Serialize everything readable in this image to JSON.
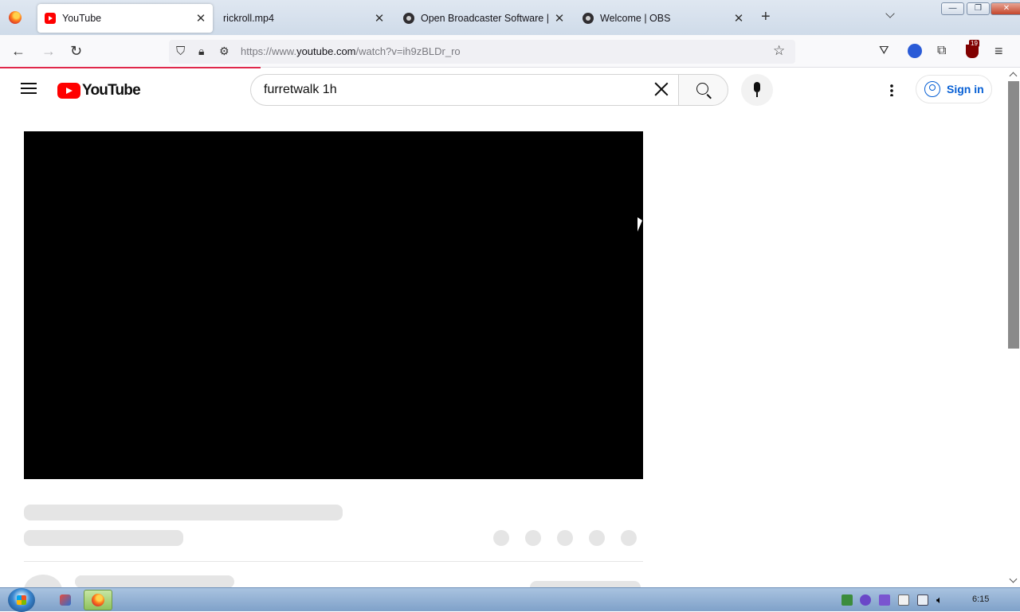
{
  "browser": {
    "tabs": [
      {
        "label": "YouTube",
        "favicon": "youtube-icon",
        "active": true
      },
      {
        "label": "rickroll.mp4",
        "favicon": "none",
        "active": false
      },
      {
        "label": "Open Broadcaster Software | OBS",
        "favicon": "obs-icon",
        "active": false
      },
      {
        "label": "Welcome | OBS",
        "favicon": "obs-icon",
        "active": false
      }
    ],
    "url": {
      "prefix": "https://www.",
      "host": "youtube.com",
      "path": "/watch?v=ih9zBLDr_ro"
    },
    "extension_badge": "19"
  },
  "youtube": {
    "logo_text": "YouTube",
    "search_query": "furretwalk 1h",
    "sign_in_label": "Sign in",
    "video_loading": true
  },
  "taskbar": {
    "clock": "6:15"
  },
  "colors": {
    "youtube_red": "#ff0000",
    "link_blue": "#065fd4",
    "skeleton_gray": "#e5e5e5"
  }
}
